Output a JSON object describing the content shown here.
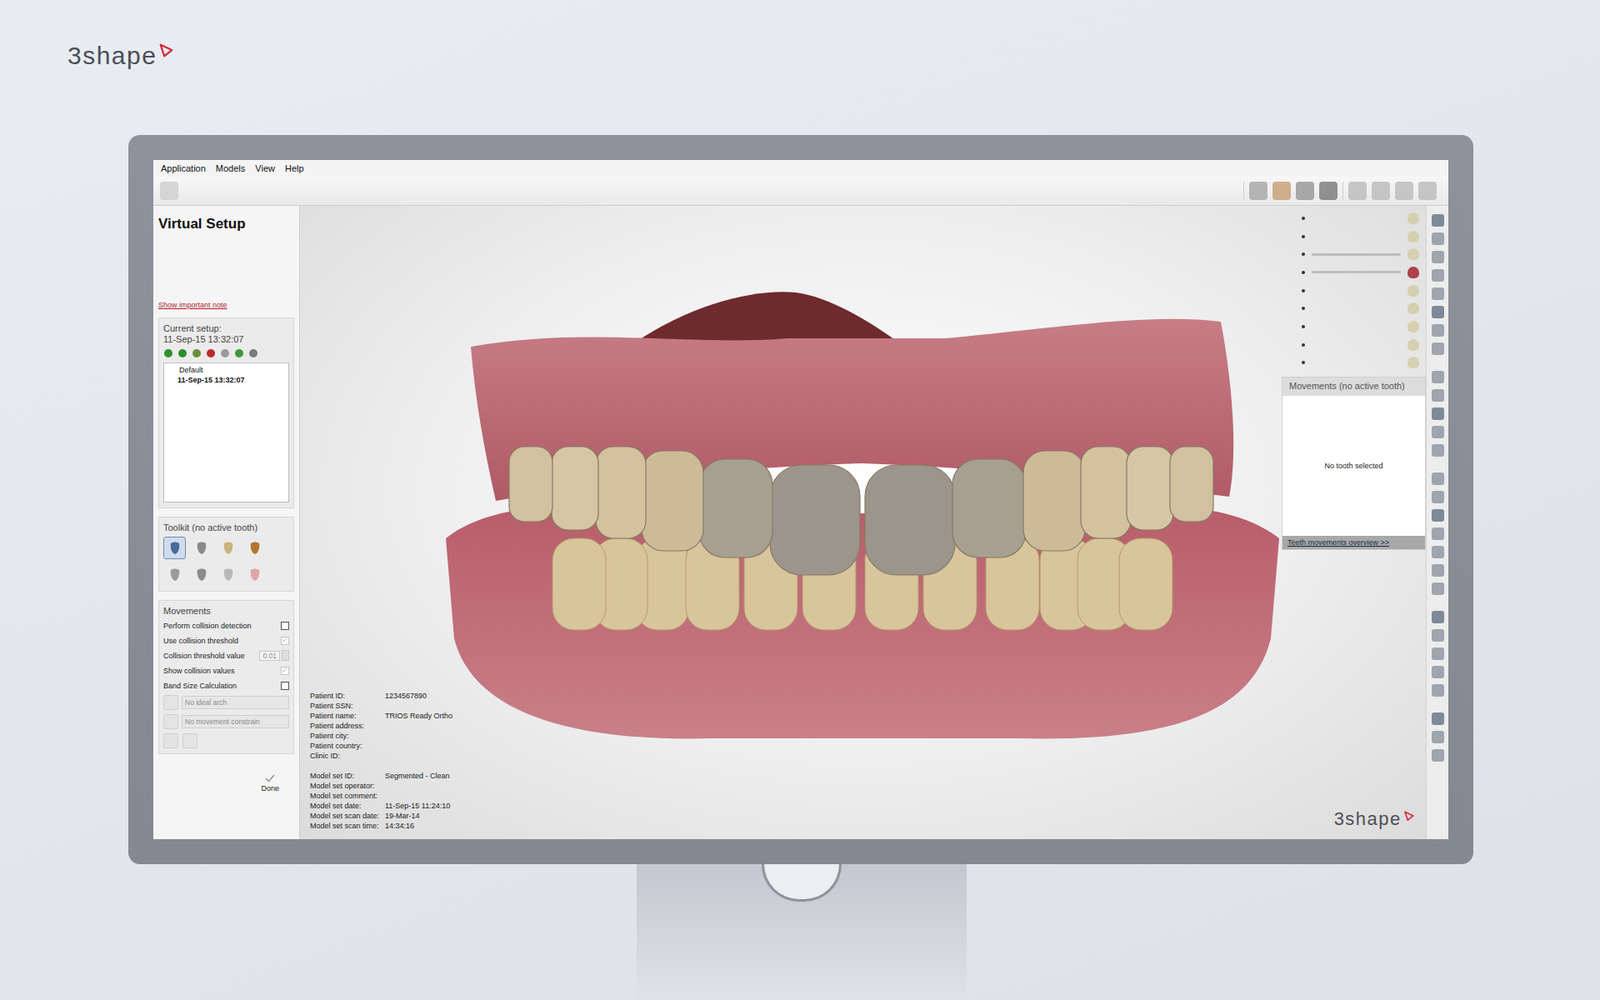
{
  "brand": {
    "name": "3shape"
  },
  "window": {
    "menu": [
      "Application",
      "Models",
      "View",
      "Help"
    ]
  },
  "left_panel": {
    "title": "Virtual Setup",
    "note_link": "Show important note",
    "current_setup": {
      "label": "Current setup:",
      "value": "11-Sep-15  13:32:07",
      "items": [
        {
          "label": "Default",
          "selected": false
        },
        {
          "label": "11-Sep-15  13:32:07",
          "selected": true
        }
      ]
    },
    "toolkit": {
      "title": "Toolkit (no active tooth)"
    },
    "movements": {
      "title": "Movements",
      "options": [
        {
          "kind": "checkbox",
          "label": "Perform collision detection",
          "checked": false,
          "disabled": false
        },
        {
          "kind": "checkbox",
          "label": "Use collision threshold",
          "checked": true,
          "disabled": true
        },
        {
          "kind": "spinner",
          "label": "Collision threshold value",
          "value": "0.01",
          "disabled": true
        },
        {
          "kind": "checkbox",
          "label": "Show collision values",
          "checked": true,
          "disabled": true
        },
        {
          "kind": "checkbox",
          "label": "Band Size Calculation",
          "checked": false,
          "disabled": false
        }
      ],
      "selects": [
        {
          "value": "No ideal arch",
          "disabled": true
        },
        {
          "value": "No movement constrain",
          "disabled": true
        }
      ]
    },
    "done": "Done"
  },
  "viewport": {
    "info_groups": [
      [
        {
          "label": "Patient ID:",
          "value": "1234567890"
        },
        {
          "label": "Patient SSN:",
          "value": ""
        },
        {
          "label": "Patient name:",
          "value": "TRIOS Ready Ortho"
        },
        {
          "label": "Patient address:",
          "value": ""
        },
        {
          "label": "Patient city:",
          "value": ""
        },
        {
          "label": "Patient country:",
          "value": ""
        },
        {
          "label": "Clinic ID:",
          "value": ""
        }
      ],
      [
        {
          "label": "Model set ID:",
          "value": "Segmented - Clean"
        },
        {
          "label": "Model set operator:",
          "value": ""
        },
        {
          "label": "Model set comment:",
          "value": ""
        },
        {
          "label": "Model set date:",
          "value": "11-Sep-15 11:24:10"
        },
        {
          "label": "Model set scan date:",
          "value": "19-Mar-14"
        },
        {
          "label": "Model set scan time:",
          "value": "14:34:16"
        }
      ]
    ],
    "logo": "3shape",
    "layers": [
      {
        "kind": "dot"
      },
      {
        "kind": "dot"
      },
      {
        "kind": "slider",
        "level": 1
      },
      {
        "kind": "slider",
        "level": 1
      },
      {
        "kind": "dot"
      },
      {
        "kind": "dot"
      },
      {
        "kind": "dot"
      },
      {
        "kind": "dot"
      },
      {
        "kind": "dot"
      }
    ]
  },
  "movements_panel": {
    "title": "Movements (no active tooth)",
    "empty": "No tooth selected",
    "link": "Teeth movements overview >>"
  }
}
